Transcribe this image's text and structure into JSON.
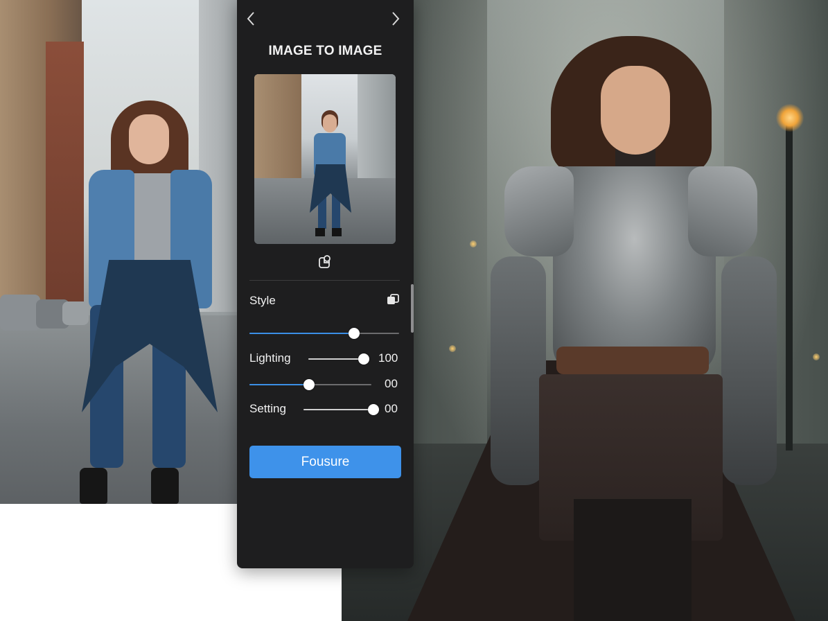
{
  "panel": {
    "title": "IMAGE TO IMAGE",
    "nav": {
      "prev_icon": "chevron-left-icon",
      "next_icon": "chevron-right-icon"
    },
    "swap_icon": "swap-image-icon",
    "controls": [
      {
        "id": "style",
        "label": "Style",
        "icon": "style-toggle-icon",
        "value": "",
        "level": 0.7
      },
      {
        "id": "lighting",
        "label": "Lighting",
        "value": "100",
        "level": 1.0
      },
      {
        "id": "lighting2",
        "label": "",
        "value": "00",
        "level": 0.49
      },
      {
        "id": "setting",
        "label": "Setting",
        "value": "00",
        "level": 1.0
      }
    ],
    "primary_button": "Fousure"
  },
  "colors": {
    "panel_bg": "#1e1e1f",
    "accent": "#3b8fe6",
    "button_bg": "#3e92ea",
    "text": "#f2f2f2"
  },
  "images": {
    "source": "woman-in-denim-jacket-street-photo",
    "result": "woman-in-armor-fantasy-street-render"
  }
}
